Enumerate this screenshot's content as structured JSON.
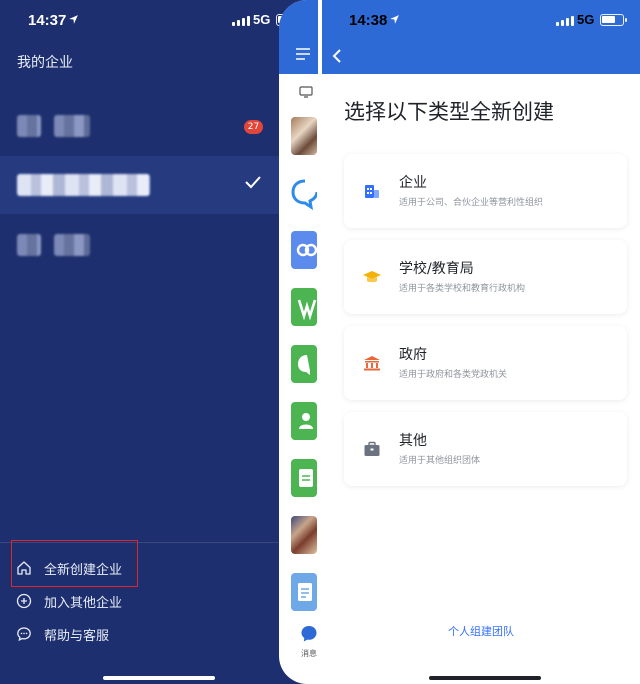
{
  "left_phone": {
    "status": {
      "time": "14:37",
      "network": "5G"
    },
    "title": "我的企业",
    "organizations": [
      {
        "name": "",
        "badge": "27",
        "selected": false
      },
      {
        "name": "",
        "selected": true
      },
      {
        "name": "",
        "selected": false
      }
    ],
    "menu": {
      "create": "全新创建企业",
      "join": "加入其他企业",
      "help": "帮助与客服"
    },
    "peek_label": "消息"
  },
  "right_phone": {
    "status": {
      "time": "14:38",
      "network": "5G"
    },
    "heading": "选择以下类型全新创建",
    "options": [
      {
        "title": "企业",
        "subtitle": "适用于公司、合伙企业等营利性组织",
        "icon": "building-icon",
        "color": "#3370ff"
      },
      {
        "title": "学校/教育局",
        "subtitle": "适用于各类学校和教育行政机构",
        "icon": "graduation-cap-icon",
        "color": "#f5b30a"
      },
      {
        "title": "政府",
        "subtitle": "适用于政府和各类党政机关",
        "icon": "government-building-icon",
        "color": "#e8683a"
      },
      {
        "title": "其他",
        "subtitle": "适用于其他组织团体",
        "icon": "briefcase-icon",
        "color": "#6b7280"
      }
    ],
    "personal_team": "个人组建团队"
  },
  "colors": {
    "drawer_bg": "#1d2f6e",
    "brand_blue": "#2e6ad6",
    "highlight_box": "#e3242b"
  }
}
